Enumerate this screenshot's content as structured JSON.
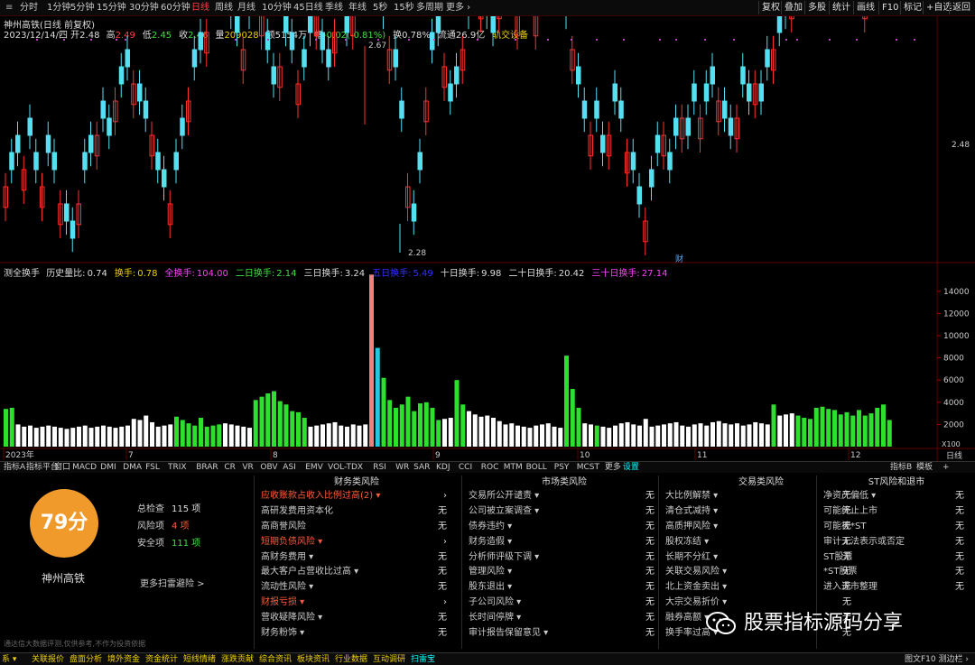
{
  "topbar": {
    "periods": [
      "分时",
      "1分钟",
      "5分钟",
      "15分钟",
      "30分钟",
      "60分钟",
      "日线",
      "周线",
      "月线",
      "10分钟",
      "45日线",
      "季线",
      "年线",
      "5秒",
      "15秒",
      "多周期",
      "更多 ›"
    ],
    "active_period": "日线",
    "right_buttons": [
      "复权",
      "叠加",
      "多股",
      "统计",
      "画线",
      "F10",
      "标记",
      "+自选",
      "返回"
    ]
  },
  "quote": {
    "name": "神州高铁(日线 前复权)",
    "date_line": "2023/12/14/四 开2.48",
    "fields": [
      {
        "label": "高",
        "value": "2.49",
        "color": "#ff4040"
      },
      {
        "label": "低",
        "value": "2.45",
        "color": "#40e040"
      },
      {
        "label": "收",
        "value": "2.46",
        "color": "#40e040"
      },
      {
        "label": "量",
        "value": "209028",
        "color": "#f0d000"
      },
      {
        "label": "额",
        "value": "5154万",
        "color": "#ddd"
      },
      {
        "label": "幅",
        "value": "-0.02(-0.81%)",
        "color": "#40e040"
      },
      {
        "label": "换",
        "value": "0.78%",
        "color": "#ddd"
      },
      {
        "label": "流通",
        "value": "26.9亿",
        "color": "#ddd"
      },
      {
        "label": "",
        "value": "轨交设备",
        "color": "#f0d000"
      }
    ]
  },
  "price_chart": {
    "high_label": "2.67",
    "low_label": "2.28",
    "price_tick": "2.48",
    "event_label": "财"
  },
  "indicator": {
    "title": "测全换手",
    "fields": [
      {
        "label": "历史量比:",
        "value": "0.74",
        "color": "#ddd"
      },
      {
        "label": "换手:",
        "value": "0.78",
        "color": "#f0d000"
      },
      {
        "label": "全换手:",
        "value": "104.00",
        "color": "#ff40ff"
      },
      {
        "label": "二日换手:",
        "value": "2.14",
        "color": "#40e040"
      },
      {
        "label": "三日换手:",
        "value": "3.24",
        "color": "#ddd"
      },
      {
        "label": "五日换手:",
        "value": "5.49",
        "color": "#3030ff"
      },
      {
        "label": "十日换手:",
        "value": "9.98",
        "color": "#ddd"
      },
      {
        "label": "二十日换手:",
        "value": "20.42",
        "color": "#ddd"
      },
      {
        "label": "三十日换手:",
        "value": "27.14",
        "color": "#ff40ff"
      }
    ],
    "y_ticks": [
      "14000",
      "12000",
      "10000",
      "8000",
      "6000",
      "4000",
      "2000"
    ],
    "unit": "X100"
  },
  "time_axis": {
    "labels": [
      "2023年",
      "7",
      "8",
      "9",
      "10",
      "11",
      "12"
    ],
    "right_label": "日线"
  },
  "indicator_tabs": [
    "指标A",
    "指标平台",
    "窗口",
    "MACD",
    "DMI",
    "DMA",
    "FSL",
    "TRIX",
    "BRAR",
    "CR",
    "VR",
    "OBV",
    "ASI",
    "EMV",
    "VOL-TDX",
    "RSI",
    "WR",
    "SAR",
    "KDJ",
    "CCI",
    "ROC",
    "MTM",
    "BOLL",
    "PSY",
    "MCST",
    "更多",
    "设置"
  ],
  "indicator_tabs_right": [
    "指标B",
    "模板",
    "+"
  ],
  "risk": {
    "score": "79分",
    "stock": "神州高铁",
    "stats": [
      {
        "label": "总检查",
        "value": "115 项",
        "color": "#ddd"
      },
      {
        "label": "风险项",
        "value": "4 项",
        "color": "#ff5a3c"
      },
      {
        "label": "安全项",
        "value": "111 项",
        "color": "#40e040"
      }
    ],
    "more": "更多扫雷避险 >",
    "disclaimer": "通达信大数据评测,仅供参考,不作为投资依据"
  },
  "columns": [
    {
      "title": "财务类风险",
      "rows": [
        {
          "t": "应收账款占收入比例过高(2) ▾",
          "s": "›",
          "hot": true
        },
        {
          "t": "高研发费用资本化",
          "s": "无"
        },
        {
          "t": "高商誉风险",
          "s": "无"
        },
        {
          "t": "短期负债风险 ▾",
          "s": "›",
          "hot": true
        },
        {
          "t": "高财务费用 ▾",
          "s": "无"
        },
        {
          "t": "最大客户占营收比过高 ▾",
          "s": "无"
        },
        {
          "t": "流动性风险 ▾",
          "s": "无"
        },
        {
          "t": "财报亏损 ▾",
          "s": "›",
          "hot": true
        },
        {
          "t": "营收疑降风险 ▾",
          "s": "无"
        },
        {
          "t": "财务粉饰 ▾",
          "s": "无"
        }
      ]
    },
    {
      "title": "市场类风险",
      "rows": [
        {
          "t": "交易所公开谴责 ▾",
          "s": "无"
        },
        {
          "t": "公司被立案调查 ▾",
          "s": "无"
        },
        {
          "t": "债券违约 ▾",
          "s": "无"
        },
        {
          "t": "财务造假 ▾",
          "s": "无"
        },
        {
          "t": "分析师评级下调 ▾",
          "s": "无"
        },
        {
          "t": "管理风险 ▾",
          "s": "无"
        },
        {
          "t": "股东退出 ▾",
          "s": "无"
        },
        {
          "t": "子公司风险 ▾",
          "s": "无"
        },
        {
          "t": "长时间停牌 ▾",
          "s": "无"
        },
        {
          "t": "审计报告保留意见 ▾",
          "s": "无"
        }
      ]
    },
    {
      "title": "交易类风险",
      "rows": [
        {
          "t": "大比例解禁 ▾",
          "s": "无"
        },
        {
          "t": "清仓式减持 ▾",
          "s": "无"
        },
        {
          "t": "高质押风险 ▾",
          "s": "无"
        },
        {
          "t": "股权冻结 ▾",
          "s": "无"
        },
        {
          "t": "长期不分红 ▾",
          "s": "无"
        },
        {
          "t": "关联交易风险 ▾",
          "s": "无"
        },
        {
          "t": "北上资金卖出 ▾",
          "s": "无"
        },
        {
          "t": "大宗交易折价 ▾",
          "s": "无"
        },
        {
          "t": "融券高额 ▾",
          "s": "无"
        },
        {
          "t": "换手率过高 ▾",
          "s": "无"
        }
      ]
    },
    {
      "title": "ST风险和退市",
      "rows": [
        {
          "t": "净资产偏低 ▾",
          "s": "无"
        },
        {
          "t": "可能终止上市",
          "s": "无"
        },
        {
          "t": "可能被*ST",
          "s": "无"
        },
        {
          "t": "审计无法表示或否定",
          "s": "无"
        },
        {
          "t": "ST股票",
          "s": "无"
        },
        {
          "t": "*ST股票",
          "s": "无"
        },
        {
          "t": "进入退市整理",
          "s": "无"
        }
      ]
    }
  ],
  "bottombar": [
    "系 ▾",
    "关联报价",
    "盘面分析",
    "境外资金",
    "资金统计",
    "短线情绪",
    "涨跌贡献",
    "综合资讯",
    "板块资讯",
    "行业数据",
    "互动调研",
    "扫雷宝"
  ],
  "bottombar_right": "图文F10 测边栏 ›",
  "watermark": "股票指标源码分享",
  "colors": {
    "up": "#ff3030",
    "down": "#54e0f0",
    "vol_white": "#ffffff",
    "vol_green": "#2ee02e",
    "vol_pink": "#f08080",
    "vol_cyan": "#24c8e0",
    "grid_red": "#5a0000"
  }
}
